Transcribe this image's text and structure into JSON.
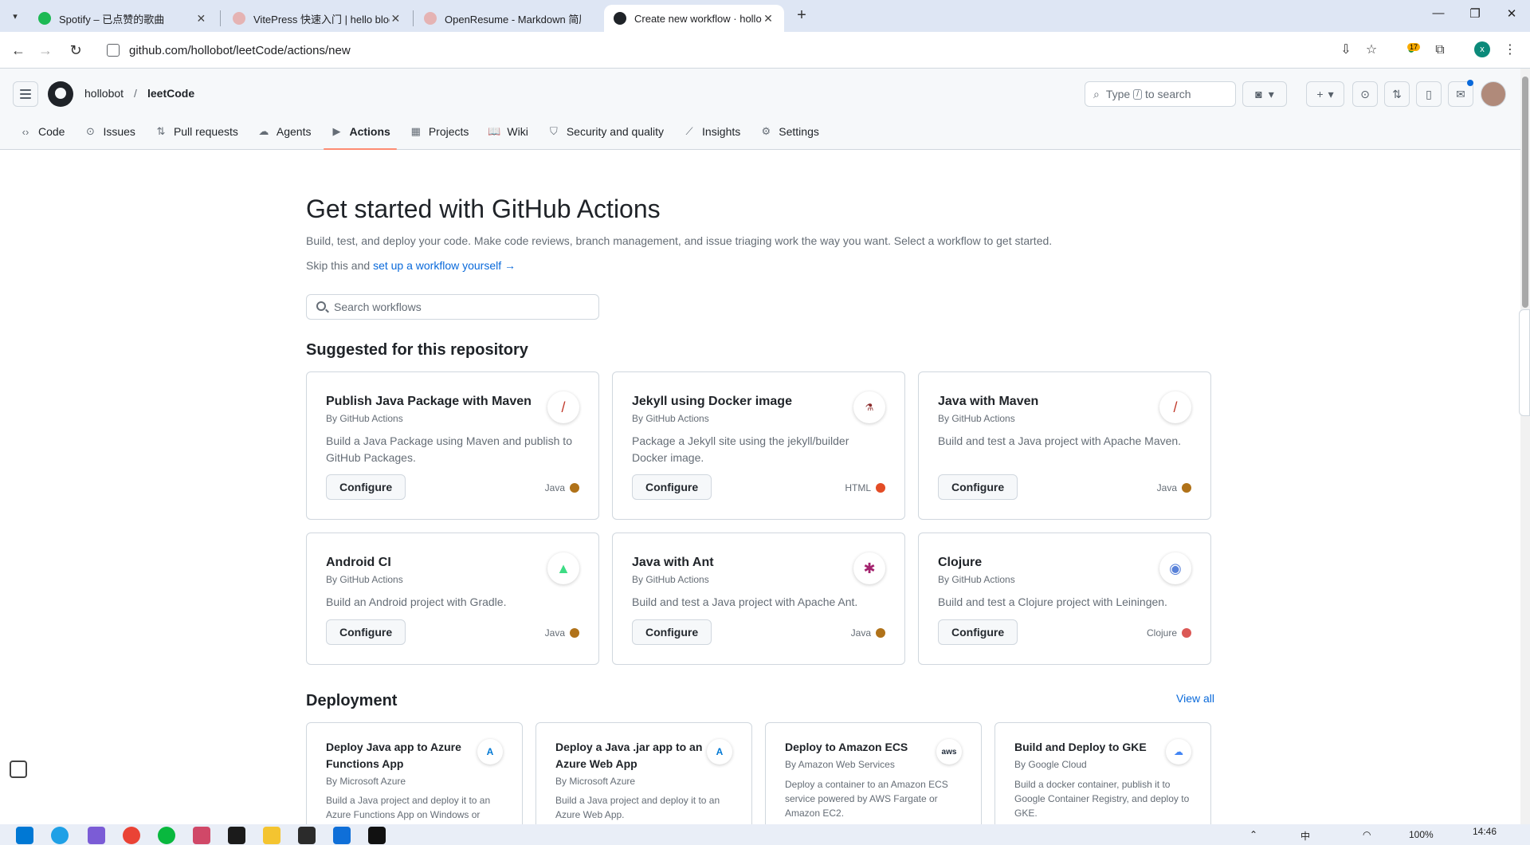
{
  "browser": {
    "tabs": [
      {
        "title": "Spotify – 已点赞的歌曲",
        "favicon_color": "#1db954",
        "active": false
      },
      {
        "title": "VitePress 快速入门 | hello blog",
        "favicon_color": "#c0392b",
        "active": false
      },
      {
        "title": "OpenResume - Markdown 简历",
        "favicon_color": "#c0392b",
        "active": false
      },
      {
        "title": "Create new workflow · hollobot",
        "favicon_color": "#1f2328",
        "active": true
      }
    ],
    "url": "github.com/hollobot/leetCode/actions/new",
    "extension_badge": "17",
    "profile_initial": "x"
  },
  "header": {
    "owner": "hollobot",
    "separator": "/",
    "repo": "leetCode",
    "search_prefix": "Type",
    "search_key": "/",
    "search_suffix": "to search"
  },
  "repo_nav": [
    {
      "label": "Code",
      "icon": "code-icon",
      "glyph": "‹›"
    },
    {
      "label": "Issues",
      "icon": "issue-icon",
      "glyph": "⊙"
    },
    {
      "label": "Pull requests",
      "icon": "pull-request-icon",
      "glyph": "⇅"
    },
    {
      "label": "Agents",
      "icon": "agents-icon",
      "glyph": "☁"
    },
    {
      "label": "Actions",
      "icon": "play-icon",
      "glyph": "▶",
      "selected": true
    },
    {
      "label": "Projects",
      "icon": "table-icon",
      "glyph": "▦"
    },
    {
      "label": "Wiki",
      "icon": "book-icon",
      "glyph": "📖"
    },
    {
      "label": "Security and quality",
      "icon": "shield-icon",
      "glyph": "⛉"
    },
    {
      "label": "Insights",
      "icon": "graph-icon",
      "glyph": "⟋"
    },
    {
      "label": "Settings",
      "icon": "gear-icon",
      "glyph": "⚙"
    }
  ],
  "page": {
    "title": "Get started with GitHub Actions",
    "lead": "Build, test, and deploy your code. Make code reviews, branch management, and issue triaging work the way you want. Select a workflow to get started.",
    "skip_prefix": "Skip this and",
    "skip_link": "set up a workflow yourself",
    "skip_arrow": "→",
    "search_placeholder": "Search workflows",
    "suggested_heading": "Suggested for this repository",
    "deployment_heading": "Deployment",
    "view_all": "View all"
  },
  "suggested": [
    {
      "title": "Publish Java Package with Maven",
      "by": "By GitHub Actions",
      "desc": "Build a Java Package using Maven and publish to GitHub Packages.",
      "button": "Configure",
      "lang": "Java",
      "lang_color": "#b07219",
      "logo": "feather-icon",
      "logo_glyph": "🪶"
    },
    {
      "title": "Jekyll using Docker image",
      "by": "By GitHub Actions",
      "desc": "Package a Jekyll site using the jekyll/builder Docker image.",
      "button": "Configure",
      "lang": "HTML",
      "lang_color": "#e34c26",
      "logo": "jekyll-icon",
      "logo_glyph": "⚗"
    },
    {
      "title": "Java with Maven",
      "by": "By GitHub Actions",
      "desc": "Build and test a Java project with Apache Maven.",
      "button": "Configure",
      "lang": "Java",
      "lang_color": "#b07219",
      "logo": "feather-icon",
      "logo_glyph": "🪶"
    },
    {
      "title": "Android CI",
      "by": "By GitHub Actions",
      "desc": "Build an Android project with Gradle.",
      "button": "Configure",
      "lang": "Java",
      "lang_color": "#b07219",
      "logo": "android-icon",
      "logo_glyph": "🤖"
    },
    {
      "title": "Java with Ant",
      "by": "By GitHub Actions",
      "desc": "Build and test a Java project with Apache Ant.",
      "button": "Configure",
      "lang": "Java",
      "lang_color": "#b07219",
      "logo": "ant-icon",
      "logo_glyph": "🐜"
    },
    {
      "title": "Clojure",
      "by": "By GitHub Actions",
      "desc": "Build and test a Clojure project with Leiningen.",
      "button": "Configure",
      "lang": "Clojure",
      "lang_color": "#db5855",
      "logo": "clojure-icon",
      "logo_glyph": "◉"
    }
  ],
  "deployment": [
    {
      "title": "Deploy Java app to Azure Functions App",
      "by": "By Microsoft Azure",
      "desc": "Build a Java project and deploy it to an Azure Functions App on Windows or",
      "logo": "azure-icon",
      "logo_glyph": "A",
      "logo_color": "#0078d4"
    },
    {
      "title": "Deploy a Java .jar app to an Azure Web App",
      "by": "By Microsoft Azure",
      "desc": "Build a Java project and deploy it to an Azure Web App.",
      "logo": "azure-icon",
      "logo_glyph": "A",
      "logo_color": "#0078d4"
    },
    {
      "title": "Deploy to Amazon ECS",
      "by": "By Amazon Web Services",
      "desc": "Deploy a container to an Amazon ECS service powered by AWS Fargate or Amazon EC2.",
      "logo": "aws-icon",
      "logo_glyph": "aws",
      "logo_color": "#232f3e"
    },
    {
      "title": "Build and Deploy to GKE",
      "by": "By Google Cloud",
      "desc": "Build a docker container, publish it to Google Container Registry, and deploy to GKE.",
      "logo": "google-cloud-icon",
      "logo_glyph": "☁",
      "logo_color": "#4285f4"
    }
  ],
  "taskbar": {
    "clock": "14:46",
    "battery": "100%",
    "ime": "中"
  }
}
